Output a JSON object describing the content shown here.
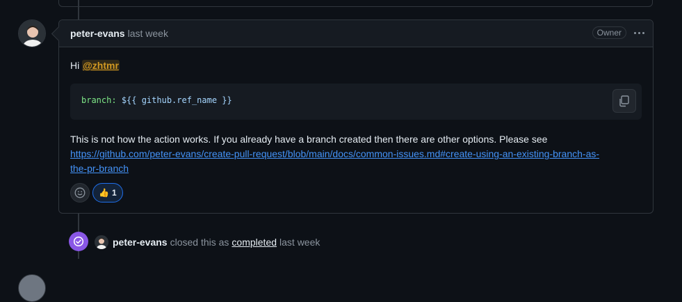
{
  "comment": {
    "author": "peter-evans",
    "timestamp": "last week",
    "role_badge": "Owner",
    "greeting": "Hi",
    "mention": "@zhtmr",
    "code": {
      "key": "branch:",
      "expression": "${{ github.ref_name }}"
    },
    "paragraph": "This is not how the action works. If you already have a branch created then there are other options. Please see",
    "link_line1": "https://github.com/peter-evans/create-pull-request/blob/main/docs/common-issues.md#create-using-an-existing-branch-as-",
    "link_line2": "the-pr-branch",
    "reactions": [
      {
        "emoji": "👍",
        "count": "1"
      }
    ]
  },
  "event": {
    "author": "peter-evans",
    "action": "closed this as",
    "state": "completed",
    "timestamp": "last week"
  },
  "colors": {
    "background": "#0d1117",
    "link": "#4493f8",
    "mention": "#d29922",
    "closed_badge": "#8957e5"
  },
  "icons": [
    "copy-icon",
    "smiley-icon",
    "kebab-icon",
    "check-circle-icon"
  ]
}
